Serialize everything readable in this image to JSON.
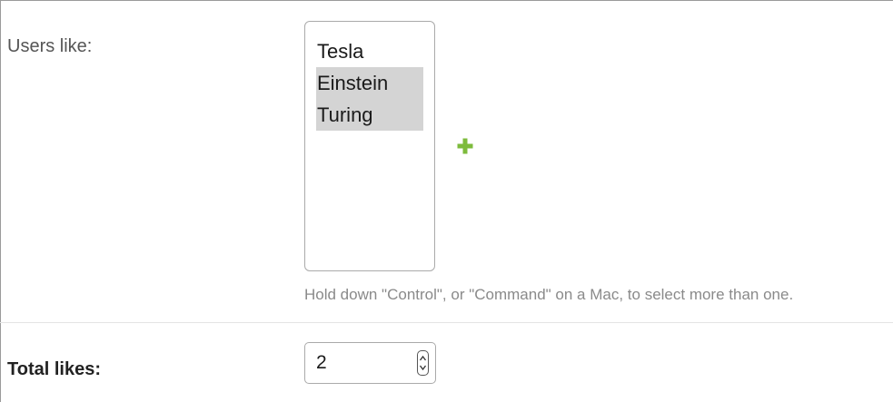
{
  "users_like": {
    "label": "Users like:",
    "options": [
      {
        "label": "Tesla",
        "selected": false
      },
      {
        "label": "Einstein",
        "selected": true
      },
      {
        "label": "Turing",
        "selected": true
      }
    ],
    "add_icon": "plus-icon",
    "add_icon_color": "#7dbb3c",
    "help_text": "Hold down \"Control\", or \"Command\" on a Mac, to select more than one."
  },
  "total_likes": {
    "label": "Total likes:",
    "value": "2",
    "spinner_icon": "up-down-arrows-icon"
  },
  "colors": {
    "selected_option_bg": "#d4d4d4",
    "border": "#aaaaaa",
    "help_text": "#8a8a8a"
  }
}
